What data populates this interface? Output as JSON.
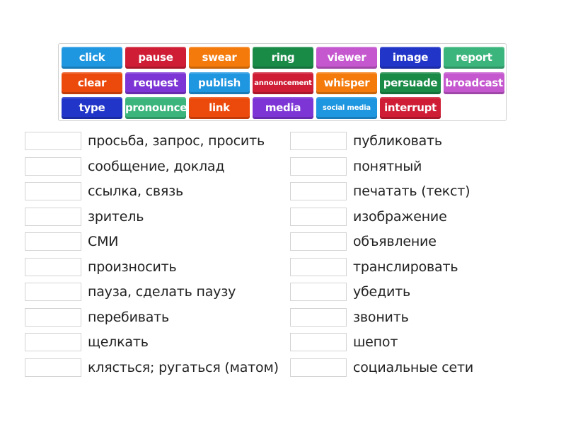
{
  "tiles": [
    {
      "text": "click",
      "color": "#1f96e0"
    },
    {
      "text": "pause",
      "color": "#cf1d35"
    },
    {
      "text": "swear",
      "color": "#f47a0c"
    },
    {
      "text": "ring",
      "color": "#1a8a47"
    },
    {
      "text": "viewer",
      "color": "#c557cf"
    },
    {
      "text": "image",
      "color": "#2135c8"
    },
    {
      "text": "report",
      "color": "#3bb57c"
    },
    {
      "text": "clear",
      "color": "#ec4a0c"
    },
    {
      "text": "request",
      "color": "#7d35d6"
    },
    {
      "text": "publish",
      "color": "#1f96e0"
    },
    {
      "text": "announcement",
      "color": "#cf1d35"
    },
    {
      "text": "whisper",
      "color": "#f47a0c"
    },
    {
      "text": "persuade",
      "color": "#1a8a47"
    },
    {
      "text": "broadcast",
      "color": "#c557cf"
    },
    {
      "text": "type",
      "color": "#2135c8"
    },
    {
      "text": "pronounce",
      "color": "#3bb57c"
    },
    {
      "text": "link",
      "color": "#ec4a0c"
    },
    {
      "text": "media",
      "color": "#7d35d6"
    },
    {
      "text": "social media",
      "color": "#1f96e0"
    },
    {
      "text": "interrupt",
      "color": "#cf1d35"
    }
  ],
  "left_column": [
    "просьба, запрос, просить",
    "сообщение, доклад",
    "ссылка, связь",
    "зритель",
    "СМИ",
    "произносить",
    "пауза, сделать паузу",
    "перебивать",
    "щелкать",
    "клясться; ругаться (матом)"
  ],
  "right_column": [
    "публиковать",
    "понятный",
    "печатать (текст)",
    "изображение",
    "объявление",
    "транслировать",
    "убедить",
    "звонить",
    "шепот",
    "социальные сети"
  ]
}
